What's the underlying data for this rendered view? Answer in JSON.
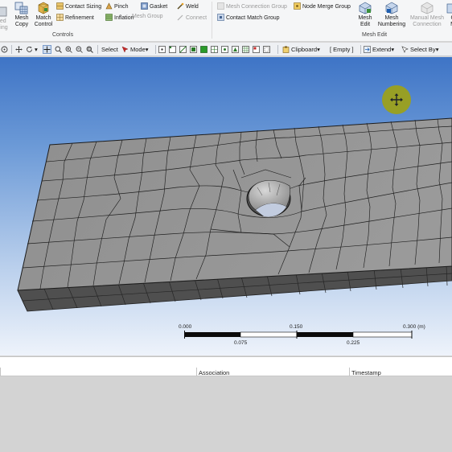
{
  "ribbon": {
    "items": {
      "mesh_copy": "Mesh\nCopy",
      "match_control": "Match\nControl",
      "contact_sizing": "Contact Sizing",
      "refinement": "Refinement",
      "pinch": "Pinch",
      "inflation": "Inflation",
      "gasket": "Gasket",
      "mesh_group": "Mesh Group",
      "weld": "Weld",
      "connect": "Connect",
      "mesh_connection_group": "Mesh Connection Group",
      "contact_match_group": "Contact Match Group",
      "node_merge_group": "Node Merge Group",
      "mesh_edit": "Mesh\nEdit",
      "mesh_numbering": "Mesh\nNumbering",
      "manual_mesh_connection": "Manual Mesh\nConnection",
      "left_cut_top": "ied",
      "left_cut_bottom": "hing",
      "right_cut_top": "C",
      "right_cut_bottom": "M"
    },
    "groups": {
      "controls": "Controls",
      "mesh_edit": "Mesh Edit"
    }
  },
  "toolbar": {
    "select": "Select",
    "mode": "Mode",
    "clipboard": "Clipboard",
    "empty": "[ Empty ]",
    "extend": "Extend",
    "select_by": "Select By"
  },
  "scale_bar": {
    "top_labels": [
      "0.000",
      "0.150",
      "0.300 (m)"
    ],
    "bottom_labels": [
      "0.075",
      "0.225"
    ]
  },
  "panel": {
    "columns": [
      "Association",
      "Timestamp"
    ]
  },
  "colors": {
    "viewport_top": "#3e74c6",
    "viewport_bottom": "#eef3fb",
    "mesh_face": "#8e8e8e",
    "mesh_side": "#5a5a5a",
    "cursor_indicator": "#9ea217"
  }
}
